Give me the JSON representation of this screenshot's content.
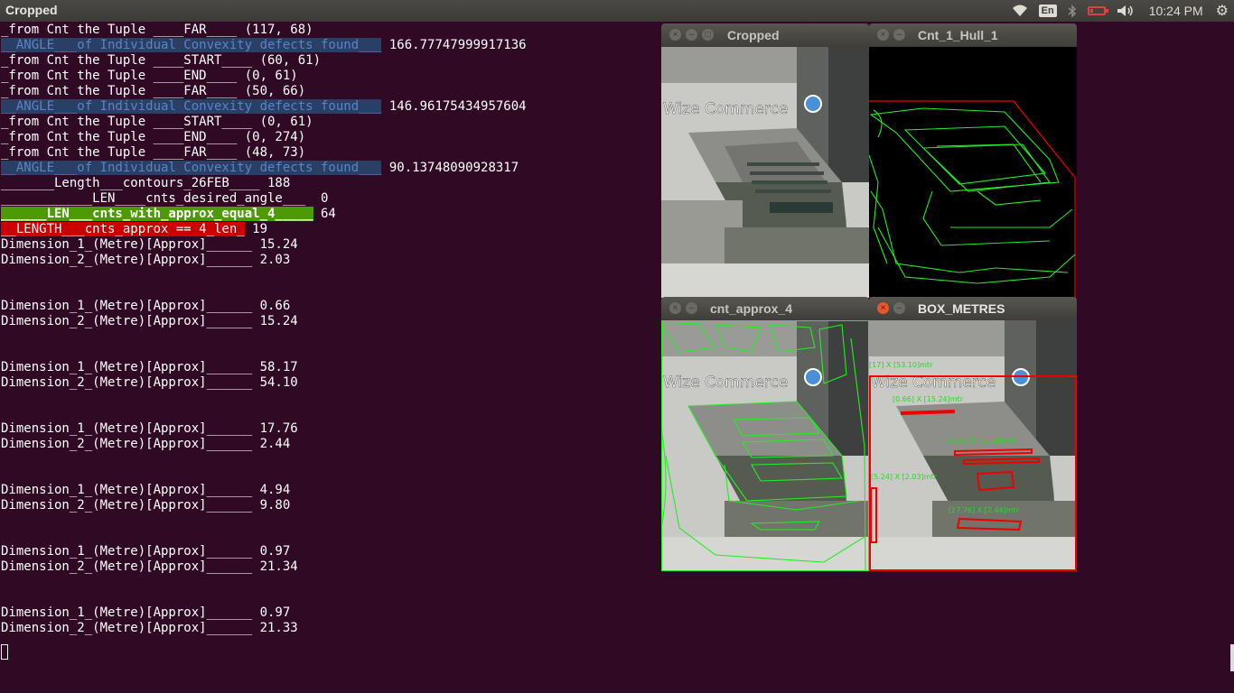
{
  "top_panel": {
    "app_title": "Cropped",
    "keyboard_layout": "En",
    "clock": "10:24 PM"
  },
  "terminal": {
    "lines": [
      {
        "text": "_from Cnt the Tuple ____FAR____ (117, 68)"
      },
      {
        "hl": "__ANGLE___of Individual Convexity defects found___",
        "tail": " 166.77747999917136"
      },
      {
        "text": "_from Cnt the Tuple ____START____ (60, 61)"
      },
      {
        "text": "_from Cnt the Tuple ____END____ (0, 61)"
      },
      {
        "text": "_from Cnt the Tuple ____FAR____ (50, 66)"
      },
      {
        "hl": "__ANGLE___of Individual Convexity defects found___",
        "tail": " 146.96175434957604"
      },
      {
        "text": "_from Cnt the Tuple ____START____ (0, 61)"
      },
      {
        "text": "_from Cnt the Tuple ____END____ (0, 274)"
      },
      {
        "text": "_from Cnt the Tuple ____FAR____ (48, 73)"
      },
      {
        "hl": "__ANGLE___of Individual Convexity defects found___",
        "tail": " 90.13748090928317"
      },
      {
        "text": "_______Length___contours_26FEB____ 188"
      },
      {
        "text": "____________LEN____cnts_desired_angle___  0"
      },
      {
        "hl_green": "______LEN___cnts_with_approx_equal_4_____",
        "tail": " 64"
      },
      {
        "hl_red": "__LENGTH___cnts_approx == 4_len_",
        "tail": " 19"
      },
      {
        "text": "Dimension_1_(Metre)[Approx]______ 15.24"
      },
      {
        "text": "Dimension_2_(Metre)[Approx]______ 2.03"
      },
      {
        "text": ""
      },
      {
        "text": ""
      },
      {
        "text": "Dimension_1_(Metre)[Approx]______ 0.66"
      },
      {
        "text": "Dimension_2_(Metre)[Approx]______ 15.24"
      },
      {
        "text": ""
      },
      {
        "text": ""
      },
      {
        "text": "Dimension_1_(Metre)[Approx]______ 58.17"
      },
      {
        "text": "Dimension_2_(Metre)[Approx]______ 54.10"
      },
      {
        "text": ""
      },
      {
        "text": ""
      },
      {
        "text": "Dimension_1_(Metre)[Approx]______ 17.76"
      },
      {
        "text": "Dimension_2_(Metre)[Approx]______ 2.44"
      },
      {
        "text": ""
      },
      {
        "text": ""
      },
      {
        "text": "Dimension_1_(Metre)[Approx]______ 4.94"
      },
      {
        "text": "Dimension_2_(Metre)[Approx]______ 9.80"
      },
      {
        "text": ""
      },
      {
        "text": ""
      },
      {
        "text": "Dimension_1_(Metre)[Approx]______ 0.97"
      },
      {
        "text": "Dimension_2_(Metre)[Approx]______ 21.34"
      },
      {
        "text": ""
      },
      {
        "text": ""
      },
      {
        "text": "Dimension_1_(Metre)[Approx]______ 0.97"
      },
      {
        "text": "Dimension_2_(Metre)[Approx]______ 21.33"
      }
    ]
  },
  "windows": {
    "cropped": {
      "title": "Cropped",
      "map_label": "Wize Commerce"
    },
    "hull": {
      "title": "Cnt_1_Hull_1"
    },
    "approx": {
      "title": "cnt_approx_4",
      "map_label": "Wize Commerce"
    },
    "box": {
      "title": "BOX_METRES",
      "map_label": "Wize Commerce",
      "labels": {
        "l1": "[17] X [53.10]mtr",
        "l2": "[0.66] X [15.24]mtr",
        "l3": "[0.97] X [21.34]mtr",
        "l4": "[5.24] X [2.03]mtr",
        "l5": "[17.76] X [2.44]mtr"
      }
    }
  },
  "colors": {
    "terminal_bg": "#300a24",
    "contour_green": "#22ee22",
    "box_red": "#ee0000"
  }
}
